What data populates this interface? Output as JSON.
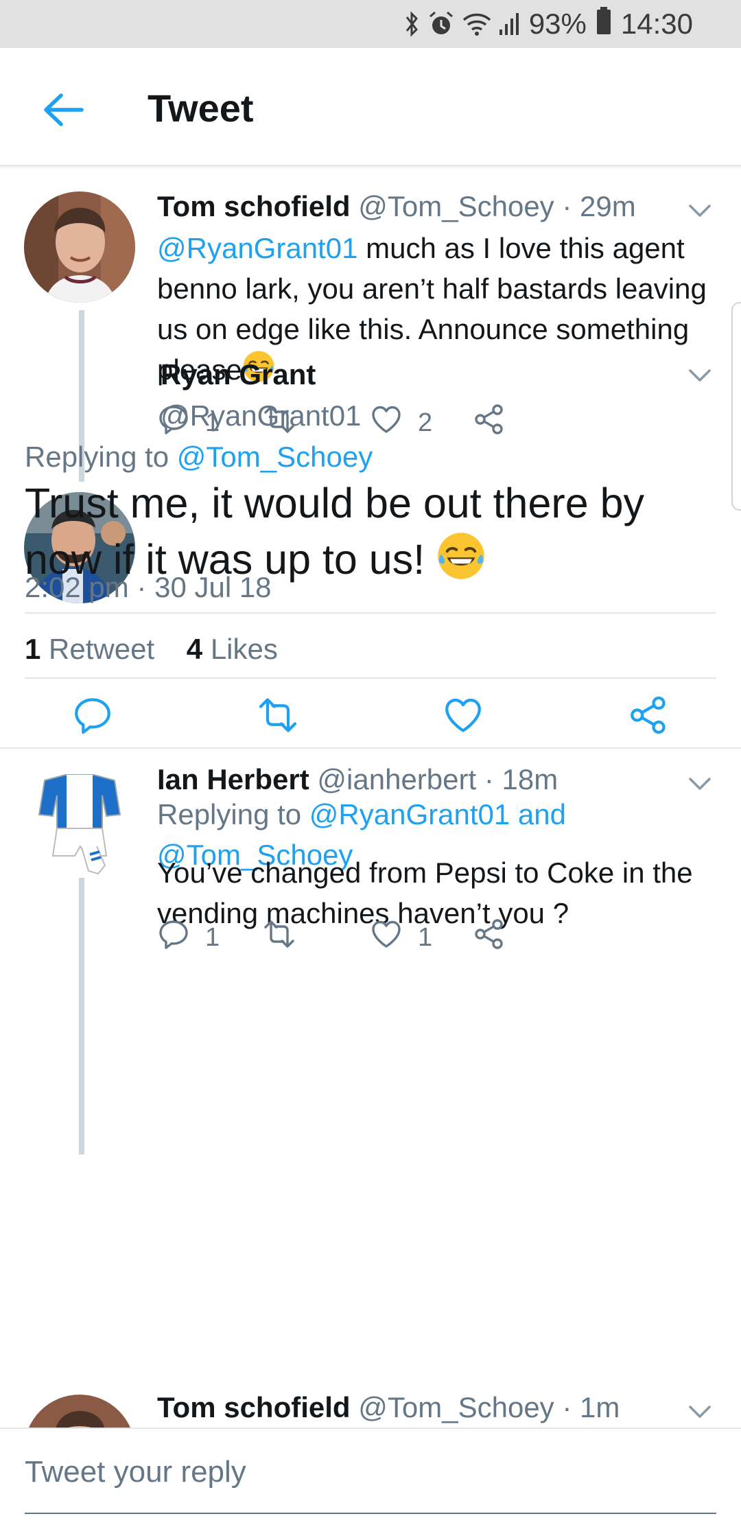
{
  "status_bar": {
    "battery": "93%",
    "time": "14:30",
    "icons": [
      "bluetooth-icon",
      "alarm-icon",
      "wifi-icon",
      "signal-icon",
      "battery-icon"
    ]
  },
  "app_bar": {
    "title": "Tweet",
    "back_icon": "back-arrow-icon"
  },
  "tweet_1": {
    "name": "Tom schofield",
    "handle": "@Tom_Schoey",
    "time": "· 29m",
    "mention": "@RyanGrant01",
    "text": " much as I love this agent benno lark, you aren’t half bastards leaving us on edge like this. Announce something please",
    "emoji": "😂",
    "replies": "1",
    "likes": "2"
  },
  "main_tweet": {
    "name": "Ryan Grant",
    "handle": "@RyanGrant01",
    "replying_prefix": "Replying to ",
    "replying_to": "@Tom_Schoey",
    "text": "Trust me, it would be out there by now if it was up to us! ",
    "emoji": "😂",
    "timestamp": "2:02 pm · 30 Jul 18",
    "retweet_count": "1",
    "retweet_label": "Retweet",
    "like_count": "4",
    "like_label": "Likes"
  },
  "tweet_3": {
    "name": "Ian Herbert",
    "handle": "@ianherbert",
    "time": "· 18m",
    "replying_prefix": "Replying to ",
    "replying_to_1": "@RyanGrant01",
    "replying_and": " and",
    "replying_to_2": "@Tom_Schoey",
    "text": "You’ve changed from Pepsi to Coke in the vending machines haven’t you ?",
    "replies": "1",
    "likes": "1"
  },
  "tweet_4": {
    "name": "Tom schofield",
    "handle": "@Tom_Schoey",
    "time": "· 1m"
  },
  "reply_bar": {
    "placeholder": "Tweet your reply"
  },
  "colors": {
    "accent": "#1da1f2",
    "secondary_text": "#657786",
    "primary_text": "#14171a",
    "divider": "#e1e8ed",
    "status_bar": "#e1e1e1"
  }
}
